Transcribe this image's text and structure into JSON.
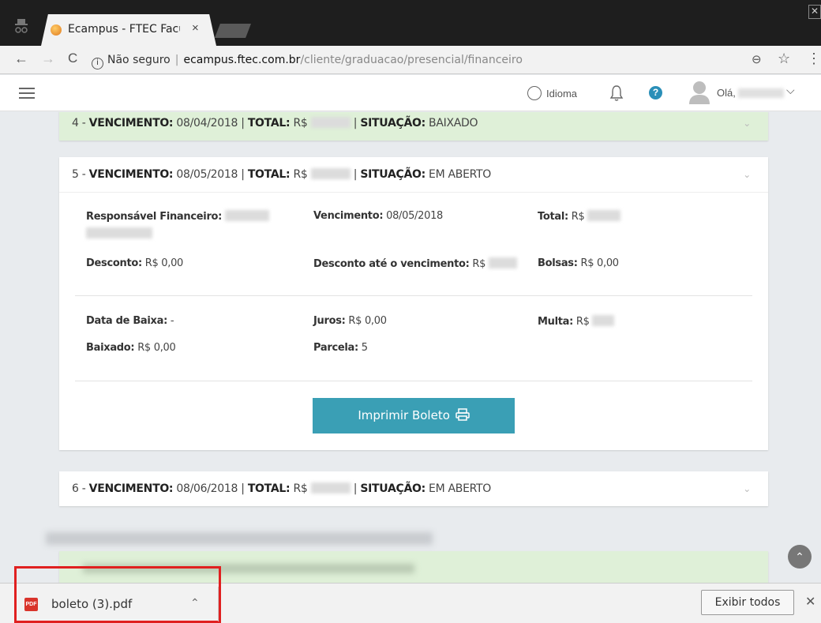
{
  "browser": {
    "tab_title": "Ecampus - FTEC Facu",
    "security_label": "Não seguro",
    "url_domain": "ecampus.ftec.com.br",
    "url_path": "/cliente/graduacao/presencial/financeiro"
  },
  "header": {
    "language_label": "Idioma",
    "greeting": "Olá,"
  },
  "installments": [
    {
      "num": "4",
      "vencimento_label": "VENCIMENTO:",
      "vencimento": "08/04/2018",
      "total_label": "TOTAL:",
      "currency": "R$",
      "situacao_label": "SITUAÇÃO:",
      "situacao": "BAIXADO",
      "expanded": false
    },
    {
      "num": "5",
      "vencimento_label": "VENCIMENTO:",
      "vencimento": "08/05/2018",
      "total_label": "TOTAL:",
      "currency": "R$",
      "situacao_label": "SITUAÇÃO:",
      "situacao": "EM ABERTO",
      "expanded": true
    },
    {
      "num": "6",
      "vencimento_label": "VENCIMENTO:",
      "vencimento": "08/06/2018",
      "total_label": "TOTAL:",
      "currency": "R$",
      "situacao_label": "SITUAÇÃO:",
      "situacao": "EM ABERTO",
      "expanded": false
    }
  ],
  "details": {
    "responsavel_label": "Responsável Financeiro:",
    "vencimento_label": "Vencimento:",
    "vencimento_value": "08/05/2018",
    "total_label": "Total:",
    "total_value": "R$",
    "desconto_label": "Desconto:",
    "desconto_value": "R$ 0,00",
    "desconto_ate_label": "Desconto até o vencimento:",
    "desconto_ate_value": "R$",
    "bolsas_label": "Bolsas:",
    "bolsas_value": "R$ 0,00",
    "data_baixa_label": "Data de Baixa:",
    "data_baixa_value": "-",
    "juros_label": "Juros:",
    "juros_value": "R$ 0,00",
    "multa_label": "Multa:",
    "multa_value": "R$",
    "baixado_label": "Baixado:",
    "baixado_value": "R$ 0,00",
    "parcela_label": "Parcela:",
    "parcela_value": "5",
    "print_button": "Imprimir Boleto"
  },
  "download_bar": {
    "file_icon_label": "PDF",
    "file_name": "boleto (3).pdf",
    "show_all": "Exibir todos"
  },
  "colors": {
    "paid_row_bg": "#dff0d8",
    "print_button_bg": "#3a9fb5",
    "highlight_border": "#e02020"
  }
}
